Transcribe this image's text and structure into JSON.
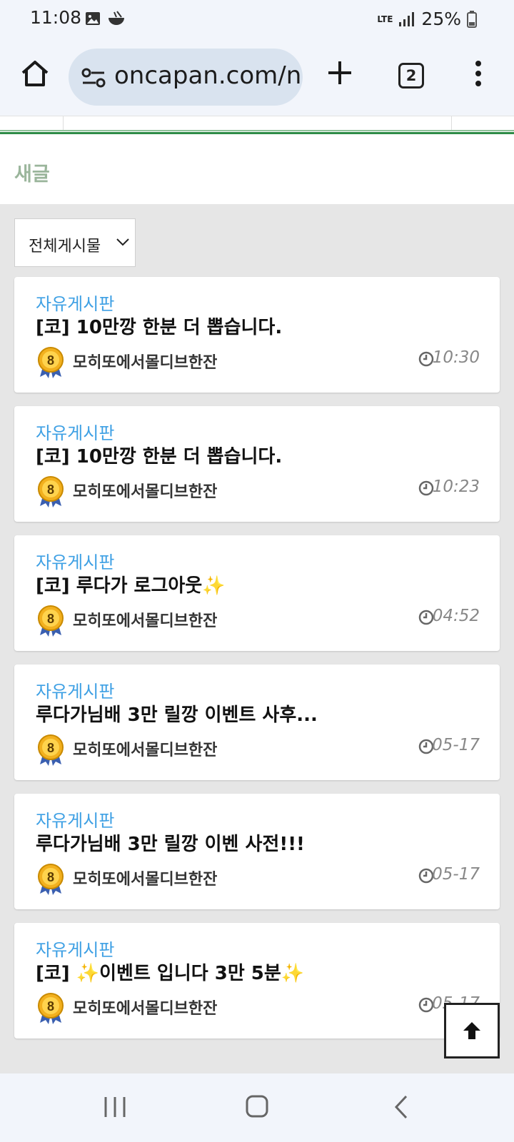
{
  "status_bar": {
    "time": "11:08",
    "network": "LTE",
    "battery": "25%"
  },
  "browser": {
    "url": "oncapan.com/ne",
    "tab_count": "2"
  },
  "page": {
    "section_title": "새글",
    "filter": {
      "selected": "전체게시물"
    }
  },
  "posts": [
    {
      "board": "자유게시판",
      "title": "[코] 10만깡 한분 더 뽑습니다.",
      "author": "모히또에서몰디브한잔",
      "level": "8",
      "time": "10:30"
    },
    {
      "board": "자유게시판",
      "title": "[코] 10만깡 한분 더 뽑습니다.",
      "author": "모히또에서몰디브한잔",
      "level": "8",
      "time": "10:23"
    },
    {
      "board": "자유게시판",
      "title": "[코] 루다가 로그아웃✨",
      "author": "모히또에서몰디브한잔",
      "level": "8",
      "time": "04:52"
    },
    {
      "board": "자유게시판",
      "title": "루다가님배 3만 릴깡 이벤트 사후...",
      "author": "모히또에서몰디브한잔",
      "level": "8",
      "time": "05-17"
    },
    {
      "board": "자유게시판",
      "title": "루다가님배 3만 릴깡 이벤 사전!!!",
      "author": "모히또에서몰디브한잔",
      "level": "8",
      "time": "05-17"
    },
    {
      "board": "자유게시판",
      "title": "[코] ✨이벤트 입니다 3만 5분✨",
      "author": "모히또에서몰디브한잔",
      "level": "8",
      "time": "05-17"
    }
  ],
  "colors": {
    "board_link": "#3ea0e4",
    "section_title": "#9ab59b",
    "accent_green": "#2e8b47"
  }
}
